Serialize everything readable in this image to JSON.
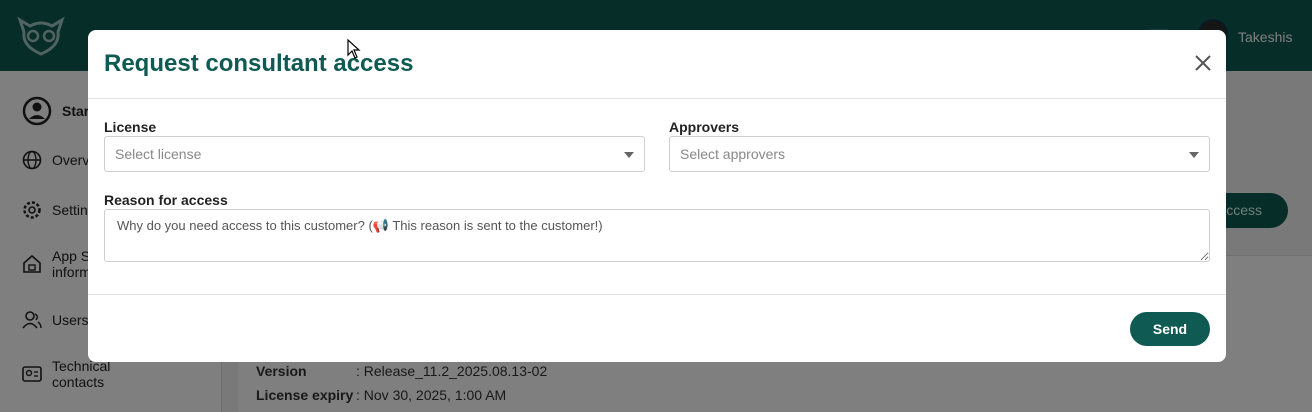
{
  "app": {
    "username": "Takeshis",
    "accent_color": "#0f5a52"
  },
  "sidebar": {
    "items": [
      {
        "label": "Star",
        "icon": "user-circle-icon"
      },
      {
        "label": "Overv",
        "icon": "globe-icon"
      },
      {
        "label": "Settin",
        "icon": "gear-icon"
      },
      {
        "label": "App St\ninform",
        "icon": "home-lock-icon"
      },
      {
        "label": "Users",
        "icon": "users-icon"
      },
      {
        "label": "Technical\ncontacts",
        "icon": "contact-card-icon"
      }
    ]
  },
  "main": {
    "access_button_label": "Access",
    "info": [
      {
        "key": "Version",
        "value": ": Release_11.2_2025.08.13-02"
      },
      {
        "key": "License expiry",
        "value": ": Nov 30, 2025, 1:00 AM"
      }
    ]
  },
  "modal": {
    "title": "Request consultant access",
    "license_label": "License",
    "license_placeholder": "Select license",
    "approvers_label": "Approvers",
    "approvers_placeholder": "Select approvers",
    "reason_label": "Reason for access",
    "reason_placeholder": "Why do you need access to this customer? (📢 This reason is sent to the customer!)",
    "send_label": "Send"
  }
}
